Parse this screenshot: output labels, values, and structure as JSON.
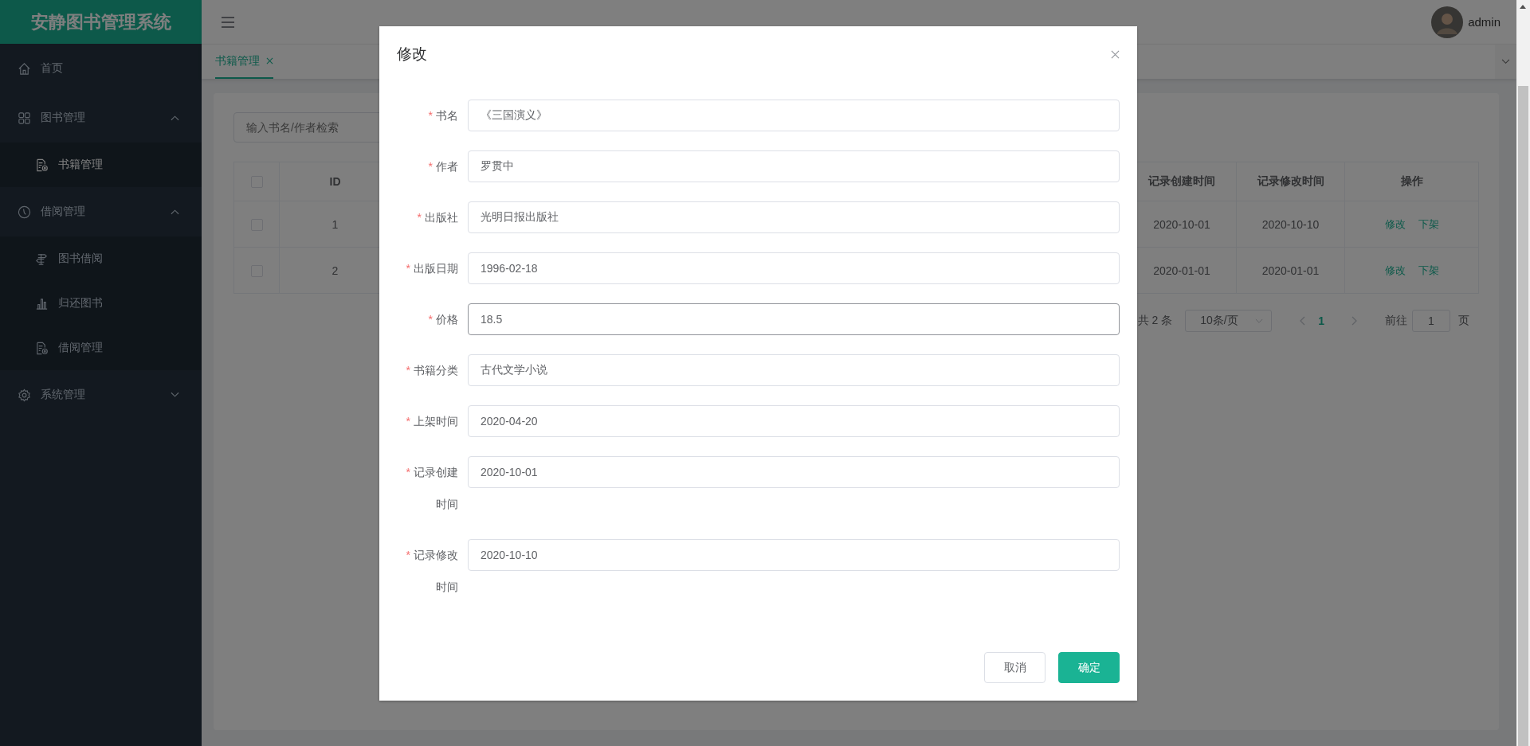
{
  "app": {
    "title": "安静图书管理系统"
  },
  "sidebar": {
    "items": [
      {
        "kind": "link",
        "label": "首页",
        "selected": false
      },
      {
        "kind": "group",
        "label": "图书管理",
        "selected": false,
        "expanded": true,
        "children": [
          {
            "label": "书籍管理",
            "selected": true
          }
        ]
      },
      {
        "kind": "group",
        "label": "借阅管理",
        "selected": false,
        "expanded": true,
        "children": [
          {
            "label": "图书借阅",
            "selected": false
          },
          {
            "label": "归还图书",
            "selected": false
          },
          {
            "label": "借阅管理",
            "selected": false
          }
        ]
      },
      {
        "kind": "group",
        "label": "系统管理",
        "selected": false,
        "expanded": false
      }
    ]
  },
  "header": {
    "user": "admin"
  },
  "tabs": [
    {
      "label": "书籍管理",
      "selected": true
    }
  ],
  "search": {
    "placeholder": "输入书名/作者检索"
  },
  "table": {
    "columns": [
      {
        "kind": "checkbox",
        "checked": false
      },
      {
        "kind": "text",
        "label": "ID"
      },
      {
        "kind": "text",
        "label": "记录创建时间"
      },
      {
        "kind": "text",
        "label": "记录修改时间"
      },
      {
        "kind": "text",
        "label": "操作"
      }
    ],
    "rows": [
      {
        "checked": false,
        "id": "1",
        "created": "2020-10-01",
        "modified": "2020-10-10",
        "actions": [
          "修改",
          "下架"
        ]
      },
      {
        "checked": false,
        "id": "2",
        "created": "2020-01-01",
        "modified": "2020-01-01",
        "actions": [
          "修改",
          "下架"
        ]
      }
    ]
  },
  "pagination": {
    "total": "共 2 条",
    "page_size": "10条/页",
    "pages": [
      {
        "label": "1",
        "selected": true
      }
    ],
    "jump_label": "前往",
    "jump_value": "1",
    "jump_suffix": "页"
  },
  "dialog": {
    "title": "修改",
    "fields": [
      {
        "required_mark": "*",
        "label": "书名",
        "value": "《三国演义》",
        "focused": false
      },
      {
        "required_mark": "*",
        "label": "作者",
        "value": "罗贯中",
        "focused": false
      },
      {
        "required_mark": "*",
        "label": "出版社",
        "value": "光明日报出版社",
        "focused": false
      },
      {
        "required_mark": "*",
        "label": "出版日期",
        "value": "1996-02-18",
        "focused": false
      },
      {
        "required_mark": "*",
        "label": "价格",
        "value": "18.5",
        "focused": true
      },
      {
        "required_mark": "*",
        "label": "书籍分类",
        "value": "古代文学小说",
        "focused": false
      },
      {
        "required_mark": "*",
        "label": "上架时间",
        "value": "2020-04-20",
        "focused": false
      },
      {
        "required_mark": "*",
        "label": "记录创建时间",
        "value": "2020-10-01",
        "focused": false
      },
      {
        "required_mark": "*",
        "label": "记录修改时间",
        "value": "2020-10-10",
        "focused": false
      }
    ],
    "buttons": [
      {
        "label": "取消",
        "kind": "default"
      },
      {
        "label": "确定",
        "kind": "primary"
      }
    ]
  }
}
